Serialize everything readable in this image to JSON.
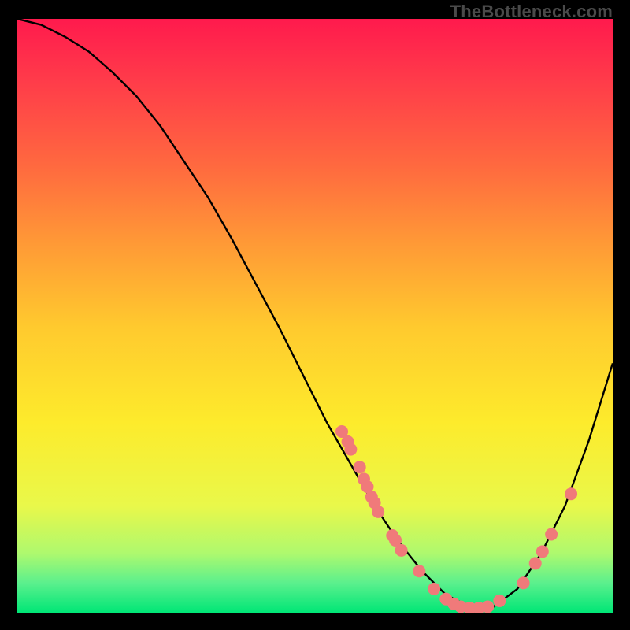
{
  "watermark": "TheBottleneck.com",
  "chart_data": {
    "type": "line",
    "title": "",
    "xlabel": "",
    "ylabel": "",
    "xlim": [
      0,
      100
    ],
    "ylim": [
      0,
      100
    ],
    "grid": false,
    "series": [
      {
        "name": "curve",
        "color": "#000000",
        "x": [
          0,
          4,
          8,
          12,
          16,
          20,
          24,
          28,
          32,
          36,
          40,
          44,
          48,
          52,
          56,
          60,
          64,
          68,
          72,
          76,
          80,
          84,
          88,
          92,
          96,
          100
        ],
        "y": [
          100,
          99,
          97,
          94.5,
          91,
          87,
          82,
          76,
          70,
          63,
          55.5,
          48,
          40,
          32,
          25,
          18,
          12,
          7,
          3,
          1,
          1,
          4,
          10,
          18,
          29,
          42
        ]
      }
    ],
    "markers": {
      "name": "dots",
      "color": "#f07a7a",
      "radius": 8,
      "points": [
        {
          "x": 54.5,
          "y": 30.5
        },
        {
          "x": 55.5,
          "y": 28.8
        },
        {
          "x": 56.0,
          "y": 27.5
        },
        {
          "x": 57.5,
          "y": 24.5
        },
        {
          "x": 58.2,
          "y": 22.5
        },
        {
          "x": 58.8,
          "y": 21.2
        },
        {
          "x": 59.5,
          "y": 19.5
        },
        {
          "x": 60.0,
          "y": 18.5
        },
        {
          "x": 60.6,
          "y": 17.0
        },
        {
          "x": 63.0,
          "y": 13.0
        },
        {
          "x": 63.5,
          "y": 12.2
        },
        {
          "x": 64.5,
          "y": 10.5
        },
        {
          "x": 67.5,
          "y": 7.0
        },
        {
          "x": 70.0,
          "y": 4.0
        },
        {
          "x": 72.0,
          "y": 2.3
        },
        {
          "x": 73.3,
          "y": 1.5
        },
        {
          "x": 74.5,
          "y": 1.0
        },
        {
          "x": 76.0,
          "y": 0.8
        },
        {
          "x": 77.5,
          "y": 0.8
        },
        {
          "x": 79.0,
          "y": 1.0
        },
        {
          "x": 81.0,
          "y": 2.0
        },
        {
          "x": 85.0,
          "y": 5.0
        },
        {
          "x": 87.0,
          "y": 8.3
        },
        {
          "x": 88.2,
          "y": 10.3
        },
        {
          "x": 89.7,
          "y": 13.2
        },
        {
          "x": 93.0,
          "y": 20.0
        }
      ]
    }
  }
}
